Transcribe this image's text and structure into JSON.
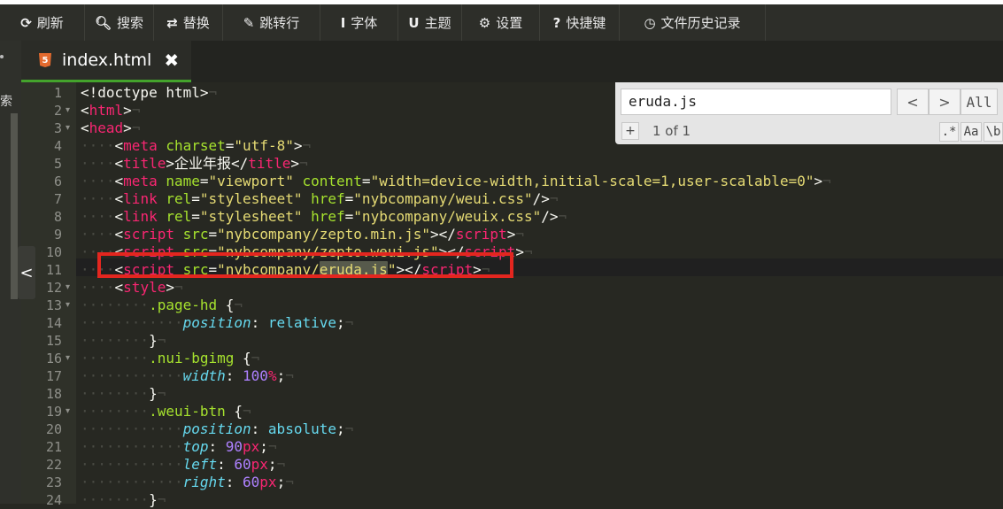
{
  "toolbar": {
    "items": [
      {
        "icon": "refresh-icon",
        "glyph": "⟳",
        "label": "刷新"
      },
      {
        "icon": "search-icon",
        "glyph": "🔍︎",
        "label": "搜索"
      },
      {
        "icon": "replace-icon",
        "glyph": "⇄",
        "label": "替换"
      },
      {
        "icon": "pin-icon",
        "glyph": "✎",
        "label": "跳转行"
      },
      {
        "icon": "font-icon",
        "glyph": "I",
        "label": "字体"
      },
      {
        "icon": "magnet-icon",
        "glyph": "U",
        "label": "主题"
      },
      {
        "icon": "gear-icon",
        "glyph": "⚙",
        "label": "设置"
      },
      {
        "icon": "help-icon",
        "glyph": "?",
        "label": "快捷键"
      },
      {
        "icon": "clock-icon",
        "glyph": "◷",
        "label": "文件历史记录"
      }
    ]
  },
  "sidebar": {
    "label": "索"
  },
  "tab": {
    "filename": "index.html",
    "icon_text": "5",
    "close": "✖"
  },
  "search": {
    "query": "eruda.js",
    "prev": "<",
    "next": ">",
    "all": "All",
    "add": "+",
    "count": "1 of 1",
    "regex": ".*",
    "case": "Aa",
    "word": "\\b"
  },
  "collapse": "<",
  "code": {
    "lines": [
      {
        "n": "1",
        "fold": false,
        "indent": 0,
        "segs": [
          [
            "p",
            "<!doctype html>"
          ]
        ]
      },
      {
        "n": "2",
        "fold": true,
        "indent": 0,
        "segs": [
          [
            "p",
            "<"
          ],
          [
            "tag",
            "html"
          ],
          [
            "p",
            ">"
          ]
        ]
      },
      {
        "n": "3",
        "fold": true,
        "indent": 0,
        "segs": [
          [
            "p",
            "<"
          ],
          [
            "tag",
            "head"
          ],
          [
            "p",
            ">"
          ]
        ]
      },
      {
        "n": "4",
        "fold": false,
        "indent": 4,
        "segs": [
          [
            "p",
            "<"
          ],
          [
            "tag",
            "meta"
          ],
          [
            "p",
            " "
          ],
          [
            "attr",
            "charset"
          ],
          [
            "p",
            "="
          ],
          [
            "str",
            "\"utf-8\""
          ],
          [
            "p",
            ">"
          ]
        ]
      },
      {
        "n": "5",
        "fold": false,
        "indent": 4,
        "segs": [
          [
            "p",
            "<"
          ],
          [
            "tag",
            "title"
          ],
          [
            "p",
            ">企业年报</"
          ],
          [
            "tag",
            "title"
          ],
          [
            "p",
            ">"
          ]
        ]
      },
      {
        "n": "6",
        "fold": false,
        "indent": 4,
        "segs": [
          [
            "p",
            "<"
          ],
          [
            "tag",
            "meta"
          ],
          [
            "p",
            " "
          ],
          [
            "attr",
            "name"
          ],
          [
            "p",
            "="
          ],
          [
            "str",
            "\"viewport\""
          ],
          [
            "p",
            " "
          ],
          [
            "attr",
            "content"
          ],
          [
            "p",
            "="
          ],
          [
            "str",
            "\"width=device-width,initial-scale=1,user-scalable=0\""
          ],
          [
            "p",
            ">"
          ]
        ]
      },
      {
        "n": "7",
        "fold": false,
        "indent": 4,
        "segs": [
          [
            "p",
            "<"
          ],
          [
            "tag",
            "link"
          ],
          [
            "p",
            " "
          ],
          [
            "attr",
            "rel"
          ],
          [
            "p",
            "="
          ],
          [
            "str",
            "\"stylesheet\""
          ],
          [
            "p",
            " "
          ],
          [
            "attr",
            "href"
          ],
          [
            "p",
            "="
          ],
          [
            "str",
            "\"nybcompany/weui.css\""
          ],
          [
            "p",
            "/>"
          ]
        ]
      },
      {
        "n": "8",
        "fold": false,
        "indent": 4,
        "segs": [
          [
            "p",
            "<"
          ],
          [
            "tag",
            "link"
          ],
          [
            "p",
            " "
          ],
          [
            "attr",
            "rel"
          ],
          [
            "p",
            "="
          ],
          [
            "str",
            "\"stylesheet\""
          ],
          [
            "p",
            " "
          ],
          [
            "attr",
            "href"
          ],
          [
            "p",
            "="
          ],
          [
            "str",
            "\"nybcompany/weuix.css\""
          ],
          [
            "p",
            "/>"
          ]
        ]
      },
      {
        "n": "9",
        "fold": false,
        "indent": 4,
        "segs": [
          [
            "p",
            "<"
          ],
          [
            "tag",
            "script"
          ],
          [
            "p",
            " "
          ],
          [
            "attr",
            "src"
          ],
          [
            "p",
            "="
          ],
          [
            "str",
            "\"nybcompany/zepto.min.js\""
          ],
          [
            "p",
            "></"
          ],
          [
            "tag",
            "script"
          ],
          [
            "p",
            ">"
          ]
        ]
      },
      {
        "n": "10",
        "fold": false,
        "indent": 4,
        "segs": [
          [
            "p",
            "<"
          ],
          [
            "tag",
            "script"
          ],
          [
            "p",
            " "
          ],
          [
            "attr",
            "src"
          ],
          [
            "p",
            "="
          ],
          [
            "str",
            "\"nybcompany/zepto.weui.js\""
          ],
          [
            "p",
            "></"
          ],
          [
            "tag",
            "script"
          ],
          [
            "p",
            ">"
          ]
        ]
      },
      {
        "n": "11",
        "fold": false,
        "indent": 4,
        "segs": [
          [
            "p",
            "<"
          ],
          [
            "tag",
            "script"
          ],
          [
            "p",
            " "
          ],
          [
            "attr",
            "src"
          ],
          [
            "p",
            "="
          ],
          [
            "str",
            "\"nybcompany/"
          ],
          [
            "match",
            "eruda.js"
          ],
          [
            "str",
            "\""
          ],
          [
            "p",
            "></"
          ],
          [
            "tag",
            "script"
          ],
          [
            "p",
            ">"
          ]
        ]
      },
      {
        "n": "12",
        "fold": true,
        "indent": 4,
        "segs": [
          [
            "p",
            "<"
          ],
          [
            "tag",
            "style"
          ],
          [
            "p",
            ">"
          ]
        ]
      },
      {
        "n": "13",
        "fold": true,
        "indent": 8,
        "segs": [
          [
            "sel",
            ".page-hd"
          ],
          [
            "p",
            " {"
          ]
        ]
      },
      {
        "n": "14",
        "fold": false,
        "indent": 12,
        "segs": [
          [
            "kw",
            "position"
          ],
          [
            "p",
            ": "
          ],
          [
            "val",
            "relative"
          ],
          [
            "p",
            ";"
          ]
        ]
      },
      {
        "n": "15",
        "fold": false,
        "indent": 8,
        "segs": [
          [
            "p",
            "}"
          ]
        ]
      },
      {
        "n": "16",
        "fold": true,
        "indent": 8,
        "segs": [
          [
            "sel",
            ".nui-bgimg"
          ],
          [
            "p",
            " {"
          ]
        ]
      },
      {
        "n": "17",
        "fold": false,
        "indent": 12,
        "segs": [
          [
            "kw",
            "width"
          ],
          [
            "p",
            ": "
          ],
          [
            "num",
            "100"
          ],
          [
            "tag",
            "%"
          ],
          [
            "p",
            ";"
          ]
        ]
      },
      {
        "n": "18",
        "fold": false,
        "indent": 8,
        "segs": [
          [
            "p",
            "}"
          ]
        ]
      },
      {
        "n": "19",
        "fold": true,
        "indent": 8,
        "segs": [
          [
            "sel",
            ".weui-btn"
          ],
          [
            "p",
            " {"
          ]
        ]
      },
      {
        "n": "20",
        "fold": false,
        "indent": 12,
        "segs": [
          [
            "kw",
            "position"
          ],
          [
            "p",
            ": "
          ],
          [
            "val",
            "absolute"
          ],
          [
            "p",
            ";"
          ]
        ]
      },
      {
        "n": "21",
        "fold": false,
        "indent": 12,
        "segs": [
          [
            "kw",
            "top"
          ],
          [
            "p",
            ": "
          ],
          [
            "num",
            "90"
          ],
          [
            "tag",
            "px"
          ],
          [
            "p",
            ";"
          ]
        ]
      },
      {
        "n": "22",
        "fold": false,
        "indent": 12,
        "segs": [
          [
            "kw",
            "left"
          ],
          [
            "p",
            ": "
          ],
          [
            "num",
            "60"
          ],
          [
            "tag",
            "px"
          ],
          [
            "p",
            ";"
          ]
        ]
      },
      {
        "n": "23",
        "fold": false,
        "indent": 12,
        "segs": [
          [
            "kw",
            "right"
          ],
          [
            "p",
            ": "
          ],
          [
            "num",
            "60"
          ],
          [
            "tag",
            "px"
          ],
          [
            "p",
            ";"
          ]
        ]
      },
      {
        "n": "24",
        "fold": false,
        "indent": 8,
        "segs": [
          [
            "p",
            "}"
          ]
        ]
      }
    ]
  },
  "colors": {
    "background": "#272822",
    "tag": "#f92672",
    "attr": "#a6e22e",
    "string": "#e6db74",
    "number": "#ae81ff",
    "keyword": "#66d9ef",
    "highlight_box": "#e3261f",
    "tab_underline": "#44a32c"
  }
}
